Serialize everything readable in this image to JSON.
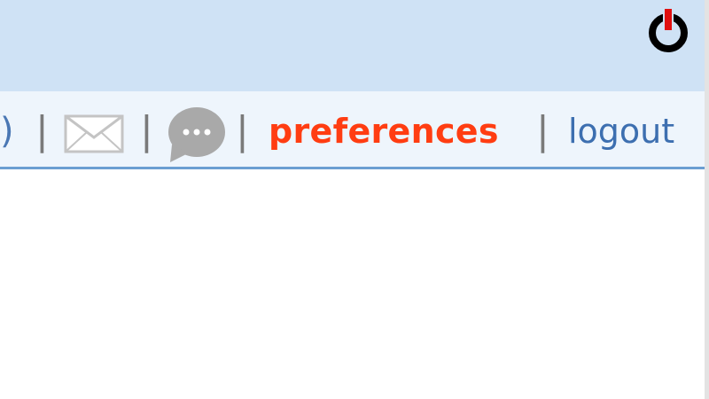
{
  "header": {
    "power_icon": "power-icon",
    "power_accent_color": "#e01010"
  },
  "nav": {
    "paren_fragment": ")",
    "separator": "|",
    "mail_icon": "envelope-icon",
    "chat_icon": "chat-bubble-icon",
    "preferences_label": "preferences",
    "logout_label": "logout",
    "preferences_color": "#ff3d12",
    "logout_color": "#3d6fb0",
    "bar_background": "#eef5fc",
    "header_background": "#cfe2f5"
  }
}
